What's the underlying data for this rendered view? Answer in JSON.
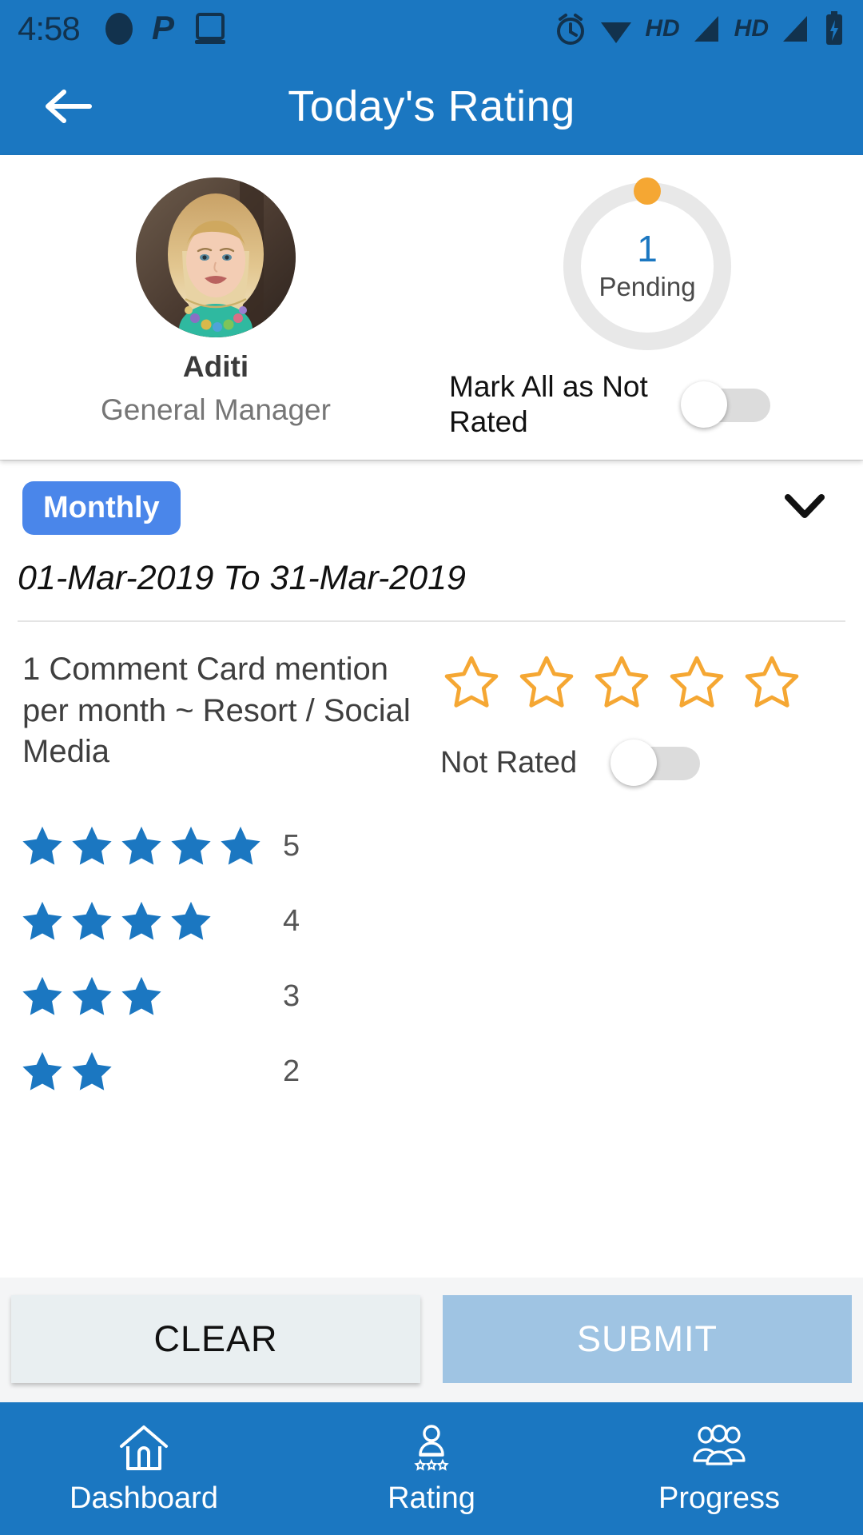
{
  "statusbar": {
    "time": "4:58",
    "hd_label_1": "HD",
    "hd_label_2": "HD",
    "icons": [
      "circle-icon",
      "parking-icon",
      "tablet-icon",
      "alarm-icon",
      "wifi-icon",
      "signal-icon",
      "battery-charging-icon"
    ]
  },
  "appbar": {
    "title": "Today's Rating",
    "back_icon": "arrow-left-icon"
  },
  "profile": {
    "name": "Aditi",
    "role": "General Manager",
    "avatar_icon": "user-photo-avatar"
  },
  "pending": {
    "count": "1",
    "label": "Pending",
    "ring_color": "#e8e8e8",
    "dot_color": "#f5a733",
    "count_color": "#1b77c1"
  },
  "mark_all": {
    "label": "Mark All as Not Rated",
    "toggle_state": "off"
  },
  "filter": {
    "period_label": "Monthly",
    "period_color": "#4a86ea",
    "chevron_icon": "chevron-down-icon",
    "date_range": "01-Mar-2019 To 31-Mar-2019"
  },
  "question": {
    "text": "1 Comment Card mention per month ~ Resort / Social Media",
    "star_count": 5,
    "stars_filled": 0,
    "star_color": "#f5a733",
    "not_rated_label": "Not Rated",
    "not_rated_toggle_state": "off"
  },
  "legend": {
    "star_color": "#1b77c1",
    "rows": [
      {
        "stars": 5,
        "value": "5"
      },
      {
        "stars": 4,
        "value": "4"
      },
      {
        "stars": 3,
        "value": "3"
      },
      {
        "stars": 2,
        "value": "2"
      }
    ]
  },
  "actions": {
    "clear_label": "CLEAR",
    "submit_label": "SUBMIT"
  },
  "bottomnav": {
    "items": [
      {
        "label": "Dashboard",
        "icon": "home-icon"
      },
      {
        "label": "Rating",
        "icon": "person-stars-icon"
      },
      {
        "label": "Progress",
        "icon": "people-group-icon"
      }
    ]
  }
}
